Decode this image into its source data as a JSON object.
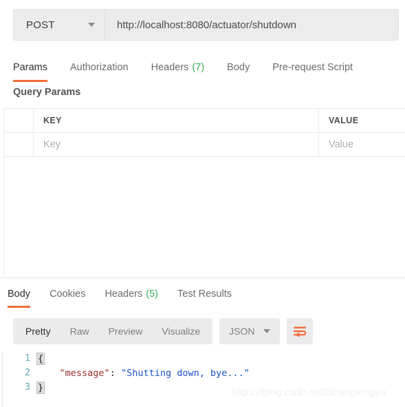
{
  "request": {
    "method": "POST",
    "method_icon": "chevron-down-icon",
    "url": "http://localhost:8080/actuator/shutdown",
    "url_placeholder": "Enter request URL",
    "tabs": [
      {
        "label": "Params",
        "count": "",
        "active": true
      },
      {
        "label": "Authorization",
        "count": "",
        "active": false
      },
      {
        "label": "Headers",
        "count": "(7)",
        "active": false
      },
      {
        "label": "Body",
        "count": "",
        "active": false
      },
      {
        "label": "Pre-request Script",
        "count": "",
        "active": false
      }
    ],
    "query_params": {
      "section_title": "Query Params",
      "columns": [
        "KEY",
        "VALUE"
      ],
      "rows": [
        {
          "key_placeholder": "Key",
          "value_placeholder": "Value"
        }
      ]
    }
  },
  "response": {
    "tabs": [
      {
        "label": "Body",
        "count": "",
        "active": true
      },
      {
        "label": "Cookies",
        "count": "",
        "active": false
      },
      {
        "label": "Headers",
        "count": "(5)",
        "active": false
      },
      {
        "label": "Test Results",
        "count": "",
        "active": false
      }
    ],
    "format_modes": [
      {
        "label": "Pretty",
        "active": true
      },
      {
        "label": "Raw",
        "active": false
      },
      {
        "label": "Preview",
        "active": false
      },
      {
        "label": "Visualize",
        "active": false
      }
    ],
    "language": "JSON",
    "language_icon": "chevron-down-icon",
    "wrap_icon": "word-wrap-icon",
    "body_lines": [
      {
        "num": "1",
        "brace": "{",
        "text": ""
      },
      {
        "num": "2",
        "brace": "",
        "key": "\"message\"",
        "punc": ": ",
        "value": "\"Shutting down, bye...\""
      },
      {
        "num": "3",
        "brace": "}",
        "text": ""
      }
    ]
  },
  "watermark": {
    "text": "https://blog.csdn.net/Shangxingya"
  },
  "colors": {
    "accent": "#f26b3a",
    "count_green": "#3bae5a",
    "gutter": "#5aa7b5",
    "json_key": "#9b2d2d",
    "json_string": "#1a52c4",
    "control_bg": "#ebebeb"
  }
}
